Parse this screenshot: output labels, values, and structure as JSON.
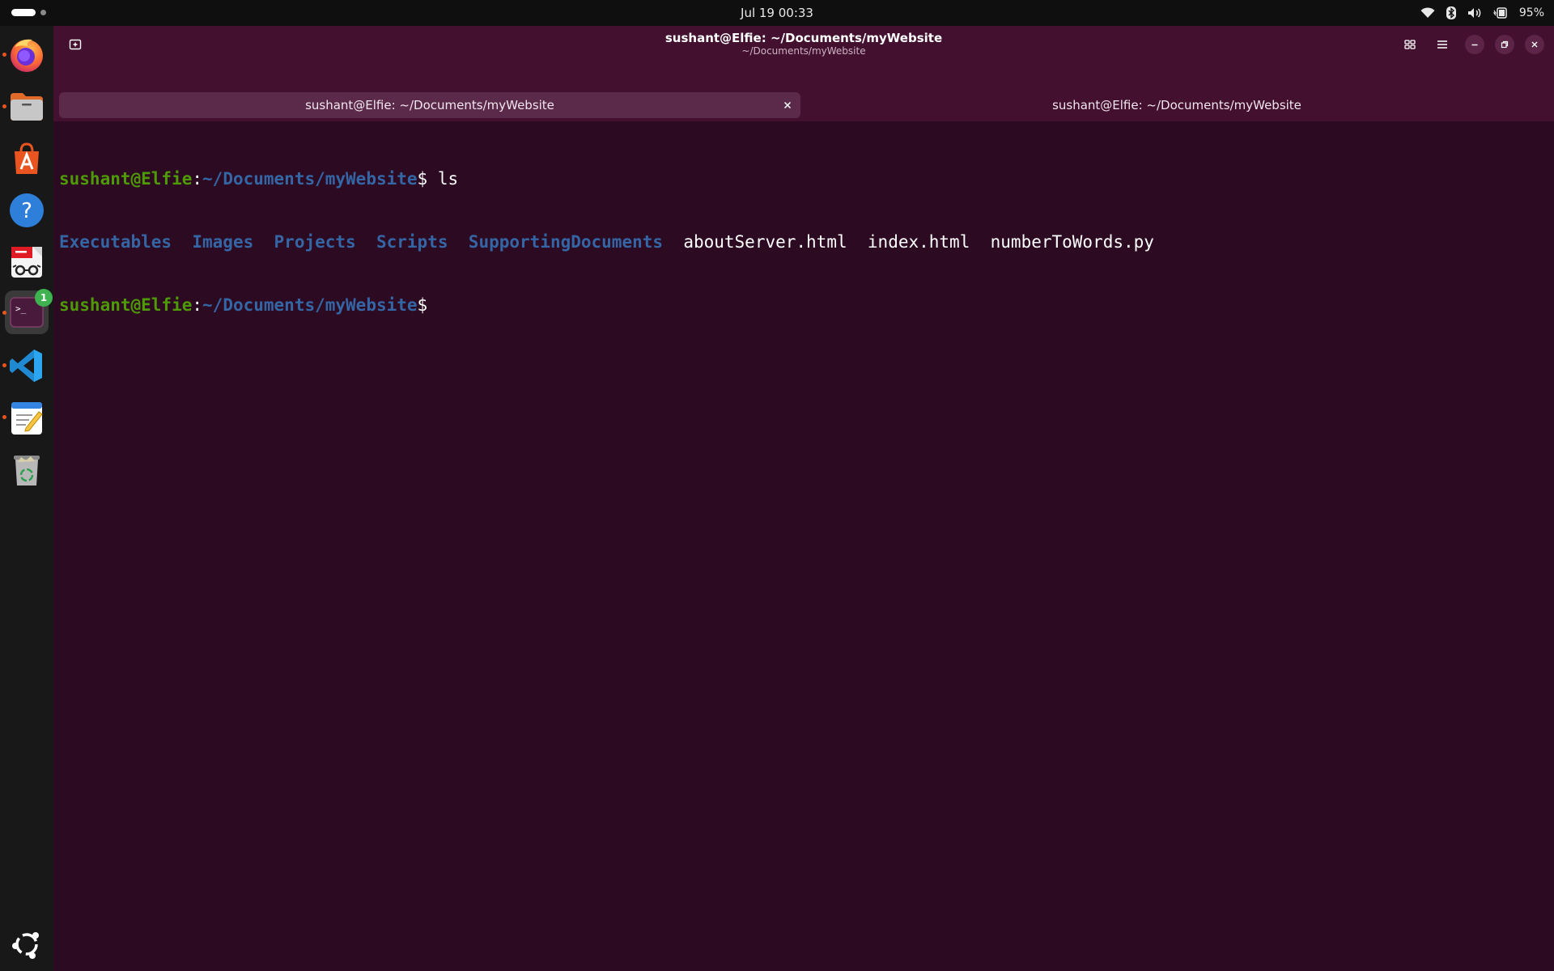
{
  "system_bar": {
    "clock": "Jul 19  00:33",
    "battery_text": "95%",
    "icons": [
      "wifi-icon",
      "bluetooth-icon",
      "volume-icon",
      "battery-icon"
    ]
  },
  "dock": {
    "items": [
      {
        "name": "firefox",
        "icon": "firefox-icon",
        "running": true
      },
      {
        "name": "files",
        "icon": "files-icon",
        "running": true
      },
      {
        "name": "app-center",
        "icon": "app-center-icon",
        "running": false
      },
      {
        "name": "help",
        "icon": "help-icon",
        "running": false
      },
      {
        "name": "document-viewer",
        "icon": "document-viewer-icon",
        "running": false
      },
      {
        "name": "terminal",
        "icon": "terminal-icon",
        "running": true,
        "active": true,
        "badge": "1"
      },
      {
        "name": "vscode",
        "icon": "vscode-icon",
        "running": true
      },
      {
        "name": "text-editor",
        "icon": "text-editor-icon",
        "running": true
      },
      {
        "name": "trash",
        "icon": "trash-icon",
        "running": false
      }
    ],
    "show_apps_icon": "ubuntu-apps-icon"
  },
  "window": {
    "title": "sushant@Elfie: ~/Documents/myWebsite",
    "subtitle": "~/Documents/myWebsite",
    "tabs": [
      {
        "label": "sushant@Elfie: ~/Documents/myWebsite",
        "active": true
      },
      {
        "label": "sushant@Elfie: ~/Documents/myWebsite",
        "active": false
      }
    ]
  },
  "terminal": {
    "prompt_user": "sushant@Elfie",
    "prompt_sep": ":",
    "prompt_path": "~/Documents/myWebsite",
    "prompt_symbol": "$",
    "command": " ls",
    "listing": {
      "dirs": [
        "Executables",
        "Images",
        "Projects",
        "Scripts",
        "SupportingDocuments"
      ],
      "files": [
        "aboutServer.html",
        "index.html",
        "numberToWords.py"
      ]
    }
  },
  "colors": {
    "terminal_bg": "#2c0a21",
    "headerbar_bg": "#43102f",
    "prompt_user": "#4e9a06",
    "prompt_path": "#3465a4",
    "accent": "#e95420"
  }
}
